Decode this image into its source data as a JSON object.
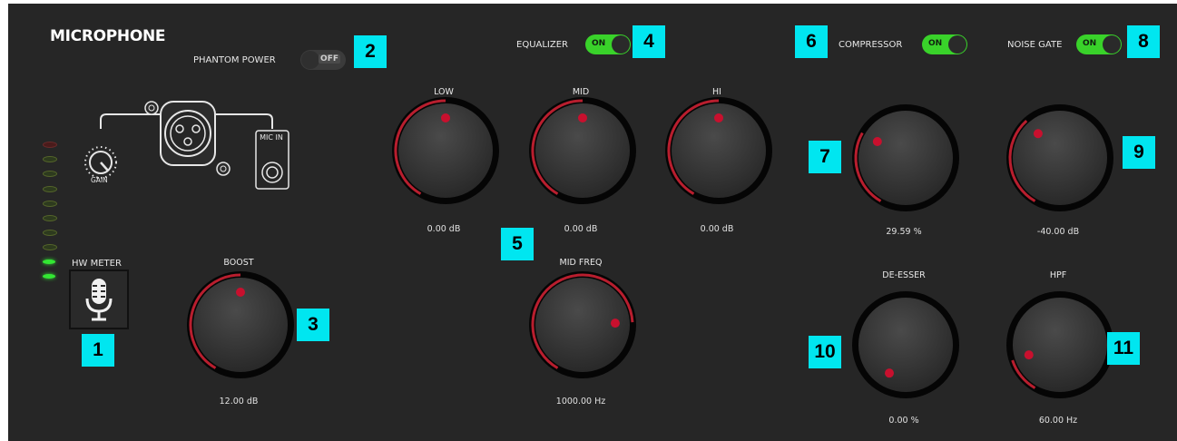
{
  "title": "MICROPHONE",
  "phantom_power": {
    "label": "PHANTOM POWER",
    "state": "OFF"
  },
  "equalizer": {
    "label": "EQUALIZER",
    "state": "ON"
  },
  "compressor": {
    "label": "COMPRESSOR",
    "state": "ON"
  },
  "noise_gate": {
    "label": "NOISE GATE",
    "state": "ON"
  },
  "gain_label": "GAIN",
  "mic_in_label": "MIC IN",
  "hw_meter": {
    "label": "HW METER",
    "lit_leds": 2,
    "total_leds": 10
  },
  "knobs": {
    "low": {
      "label": "LOW",
      "value": "0.00 dB",
      "level": 0.5
    },
    "mid": {
      "label": "MID",
      "value": "0.00 dB",
      "level": 0.5
    },
    "hi": {
      "label": "HI",
      "value": "0.00 dB",
      "level": 0.5
    },
    "boost": {
      "label": "BOOST",
      "value": "12.00 dB",
      "level": 0.5
    },
    "mid_freq": {
      "label": "MID FREQ",
      "value": "1000.00 Hz",
      "level": 0.79
    },
    "compressor_amt": {
      "label": "",
      "value": "29.59 %",
      "level": 0.3
    },
    "noise_gate_thr": {
      "label": "",
      "value": "-40.00 dB",
      "level": 0.36
    },
    "de_esser": {
      "label": "DE-ESSER",
      "value": "0.00 %",
      "level": 0.0
    },
    "hpf": {
      "label": "HPF",
      "value": "60.00 Hz",
      "level": 0.14
    }
  },
  "badges": [
    "1",
    "2",
    "3",
    "4",
    "5",
    "6",
    "7",
    "8",
    "9",
    "10",
    "11"
  ],
  "colors": {
    "panel": "#262626",
    "arc": "#b81e2e",
    "dot": "#c8102e",
    "toggle_on": "#39d22a",
    "badge": "#00e6f0",
    "led_green": "#33e633"
  }
}
